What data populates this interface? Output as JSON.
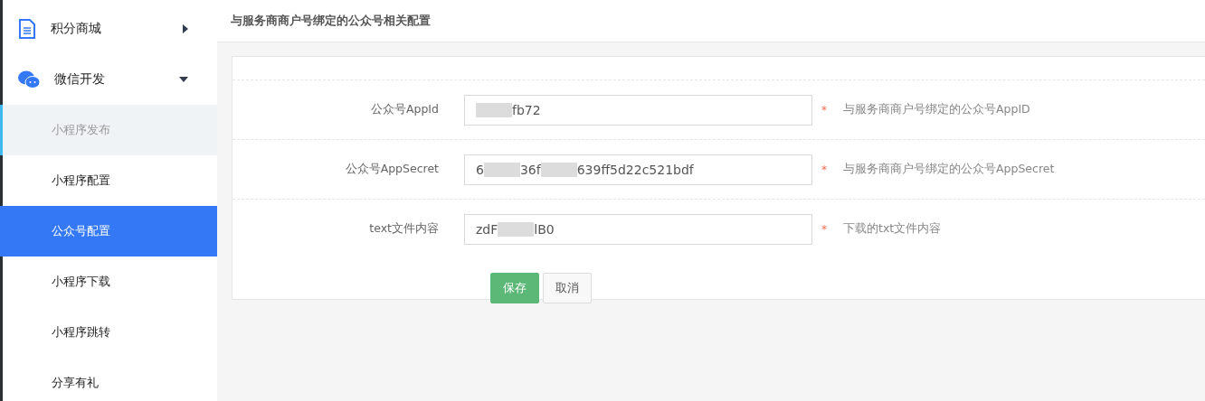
{
  "sidebar": {
    "menus": [
      {
        "label": "积分商城",
        "kind": "document",
        "expanded": false
      },
      {
        "label": "微信开发",
        "kind": "chat",
        "expanded": true,
        "children": [
          {
            "label": "小程序发布",
            "selected": false,
            "highlighted": true
          },
          {
            "label": "小程序配置",
            "selected": false,
            "highlighted": false
          },
          {
            "label": "公众号配置",
            "selected": true,
            "highlighted": false
          },
          {
            "label": "小程序下载",
            "selected": false,
            "highlighted": false
          },
          {
            "label": "小程序跳转",
            "selected": false,
            "highlighted": false
          },
          {
            "label": "分享有礼",
            "selected": false,
            "highlighted": false
          }
        ]
      }
    ]
  },
  "page": {
    "title": "与服务商商户号绑定的公众号相关配置"
  },
  "form": {
    "fields": [
      {
        "label": "公众号AppId",
        "segments": [
          {
            "kind": "mask"
          },
          {
            "kind": "text",
            "text": "fb72"
          }
        ],
        "required_mark": "*",
        "hint": "与服务商商户号绑定的公众号AppID"
      },
      {
        "label": "公众号AppSecret",
        "segments": [
          {
            "kind": "text",
            "text": "6"
          },
          {
            "kind": "mask"
          },
          {
            "kind": "text",
            "text": "36f"
          },
          {
            "kind": "mask"
          },
          {
            "kind": "text",
            "text": "639ff5d22c521bdf"
          }
        ],
        "required_mark": "*",
        "hint": "与服务商商户号绑定的公众号AppSecret"
      },
      {
        "label": "text文件内容",
        "segments": [
          {
            "kind": "text",
            "text": "zdF"
          },
          {
            "kind": "mask"
          },
          {
            "kind": "text",
            "text": "lB0"
          }
        ],
        "required_mark": "*",
        "hint": "下载的txt文件内容"
      }
    ],
    "buttons": [
      {
        "label": "保存",
        "kind": "primary"
      },
      {
        "label": "取消",
        "kind": "default"
      }
    ]
  }
}
